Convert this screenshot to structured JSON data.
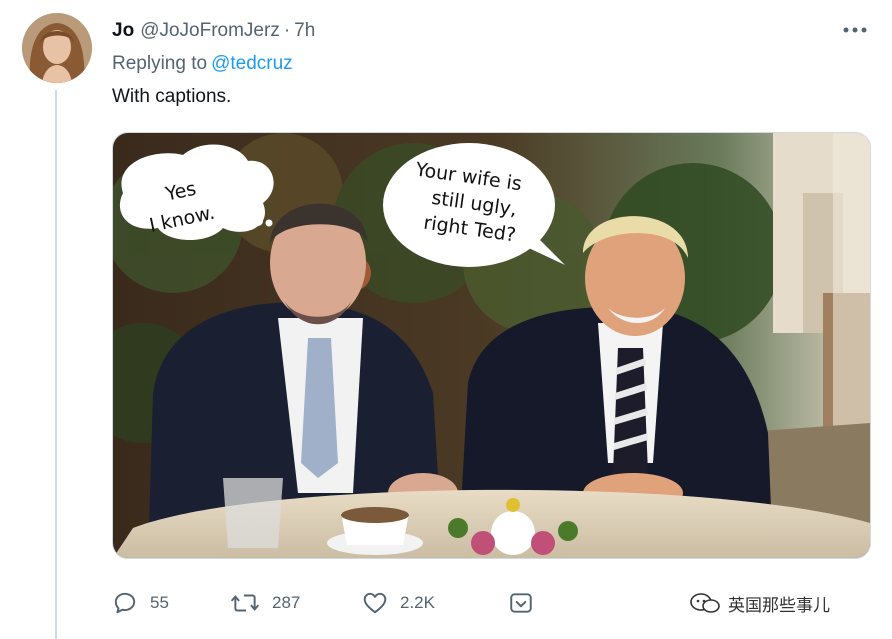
{
  "tweet": {
    "display_name": "Jo",
    "handle": "@JoJoFromJerz",
    "separator": "·",
    "time": "7h",
    "replying_prefix": "Replying to",
    "replying_to": "@tedcruz",
    "text": "With captions."
  },
  "media": {
    "caption_left": [
      "Yes",
      "I know."
    ],
    "caption_right": [
      "Your wife is",
      "still ugly,",
      "right Ted?"
    ]
  },
  "actions": {
    "reply_count": "55",
    "retweet_count": "287",
    "like_count": "2.2K"
  },
  "watermark": {
    "text": "英国那些事儿"
  },
  "colors": {
    "secondary_text": "#536471",
    "link": "#1d9bf0",
    "thread_line": "#cfd9de"
  }
}
